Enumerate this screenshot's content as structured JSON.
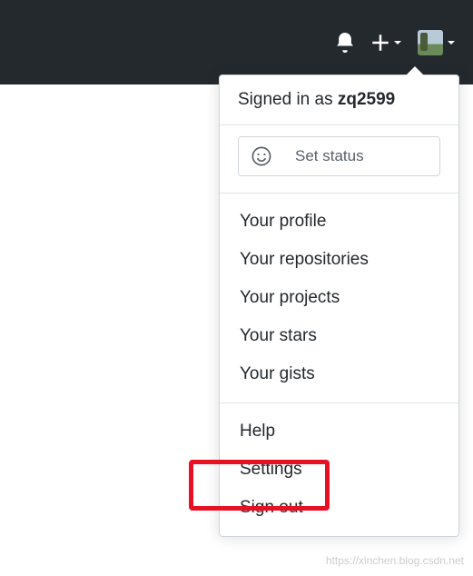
{
  "header": {
    "icons": {
      "bell": "notifications-icon",
      "plus": "plus-icon",
      "avatar": "avatar"
    }
  },
  "dropdown": {
    "signed_in_prefix": "Signed in as ",
    "username": "zq2599",
    "status_placeholder": "Set status",
    "section1": [
      "Your profile",
      "Your repositories",
      "Your projects",
      "Your stars",
      "Your gists"
    ],
    "section2": [
      "Help",
      "Settings",
      "Sign out"
    ]
  },
  "watermark": "https://xinchen.blog.csdn.net",
  "highlight_color": "#e81123"
}
